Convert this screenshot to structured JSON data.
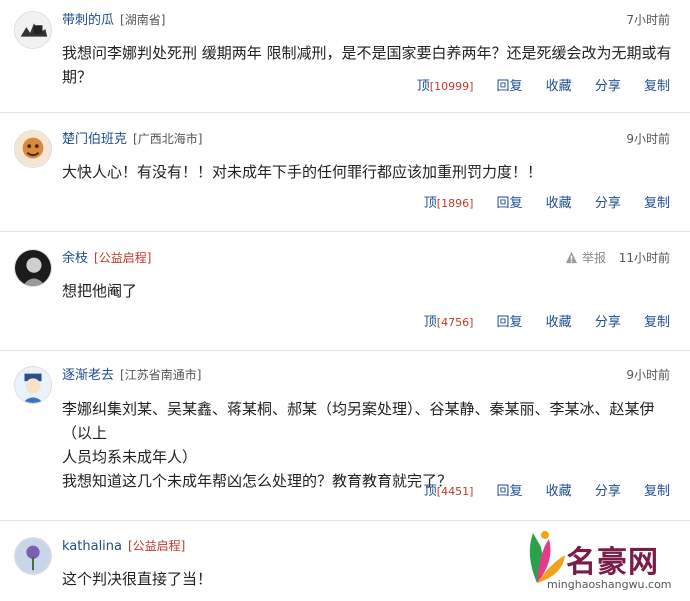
{
  "comments": [
    {
      "username": "带刺的瓜",
      "location": "[湖南省]",
      "time": "7小时前",
      "text": "我想问李娜判处死刑 缓期两年 限制减刑，是不是国家要白养两年？还是死缓会改为无期或有期？",
      "actions": {
        "ding": "顶",
        "count": "[10999]",
        "reply": "回复",
        "collect": "收藏",
        "share": "分享",
        "copy": "复制"
      }
    },
    {
      "username": "楚门伯班克",
      "location": "[广西北海市]",
      "time": "9小时前",
      "text": "大快人心！有没有！！对未成年下手的任何罪行都应该加重刑罚力度！！",
      "actions": {
        "ding": "顶",
        "count": "[1896]",
        "reply": "回复",
        "collect": "收藏",
        "share": "分享",
        "copy": "复制"
      }
    },
    {
      "username": "余枝",
      "location": "[公益启程]",
      "report": "举报",
      "time": "11小时前",
      "text": "想把他阉了",
      "actions": {
        "ding": "顶",
        "count": "[4756]",
        "reply": "回复",
        "collect": "收藏",
        "share": "分享",
        "copy": "复制"
      }
    },
    {
      "username": "逐渐老去",
      "location": "[江苏省南通市]",
      "time": "9小时前",
      "text_lines": [
        "李娜纠集刘某、吴某鑫、蒋某桐、郝某（均另案处理）、谷某静、秦某丽、李某冰、赵某伊（以上",
        "人员均系未成年人）",
        "我想知道这几个未成年帮凶怎么处理的？教育教育就完了？"
      ],
      "actions": {
        "ding": "顶",
        "count": "[4451]",
        "reply": "回复",
        "collect": "收藏",
        "share": "分享",
        "copy": "复制"
      }
    },
    {
      "username": "kathalina",
      "location": "[公益启程]",
      "text": "这个判决很直接了当！"
    }
  ],
  "watermark": {
    "name": "名豪网",
    "url": "minghaoshangwu.com"
  },
  "colors": {
    "link": "#1e4e8c",
    "count_red": "#c0392b",
    "divider": "#e3e3e3"
  }
}
